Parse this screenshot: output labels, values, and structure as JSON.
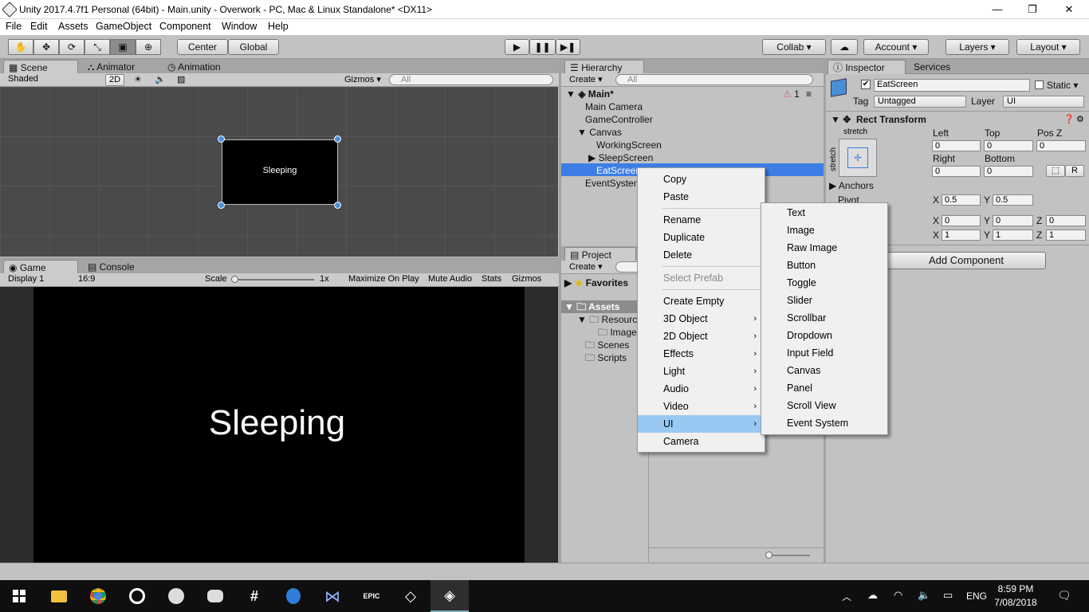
{
  "window": {
    "title": "Unity 2017.4.7f1 Personal (64bit) - Main.unity - Overwork - PC, Mac & Linux Standalone* <DX11>",
    "min": "—",
    "max": "❐",
    "close": "✕"
  },
  "menu": [
    "File",
    "Edit",
    "Assets",
    "GameObject",
    "Component",
    "Window",
    "Help"
  ],
  "toolbar": {
    "center": "Center",
    "global": "Global",
    "collab": "Collab",
    "account": "Account",
    "layers": "Layers",
    "layout": "Layout",
    "play": "▶",
    "pause": "❚❚",
    "step": "▶❚"
  },
  "scene": {
    "tabs": [
      "Scene",
      "Animator",
      "Animation"
    ],
    "shaded": "Shaded",
    "mode2d": "2D",
    "gizmos": "Gizmos",
    "search": "All",
    "canvas_text": "Sleeping"
  },
  "game": {
    "tabs": [
      "Game",
      "Console"
    ],
    "display": "Display 1",
    "aspect": "16:9",
    "scale_label": "Scale",
    "scale_val": "1x",
    "maximize": "Maximize On Play",
    "mute": "Mute Audio",
    "stats": "Stats",
    "gizmos": "Gizmos",
    "text": "Sleeping"
  },
  "hierarchy": {
    "tab": "Hierarchy",
    "create": "Create",
    "search": "All",
    "scene": "Main*",
    "count": "1",
    "items": [
      "Main Camera",
      "GameController",
      "Canvas",
      "WorkingScreen",
      "SleepScreen",
      "EatScreen",
      "EventSystem"
    ]
  },
  "project": {
    "tab": "Project",
    "create": "Create",
    "favorites": "Favorites",
    "assets": "Assets",
    "items": [
      "Resources",
      "Images",
      "Scenes",
      "Scripts"
    ]
  },
  "context_menu": {
    "items": [
      "Copy",
      "Paste",
      "Rename",
      "Duplicate",
      "Delete",
      "Select Prefab",
      "Create Empty",
      "3D Object",
      "2D Object",
      "Effects",
      "Light",
      "Audio",
      "Video",
      "UI",
      "Camera"
    ],
    "arrow": "›"
  },
  "submenu": {
    "items": [
      "Text",
      "Image",
      "Raw Image",
      "Button",
      "Toggle",
      "Slider",
      "Scrollbar",
      "Dropdown",
      "Input Field",
      "Canvas",
      "Panel",
      "Scroll View",
      "Event System"
    ]
  },
  "inspector": {
    "tabs": [
      "Inspector",
      "Services"
    ],
    "name": "EatScreen",
    "static": "Static",
    "tag_label": "Tag",
    "tag": "Untagged",
    "layer_label": "Layer",
    "layer": "UI",
    "component": "Rect Transform",
    "stretch_h": "stretch",
    "stretch_v": "stretch",
    "left_l": "Left",
    "top_l": "Top",
    "posz_l": "Pos Z",
    "left": "0",
    "top": "0",
    "posz": "0",
    "right_l": "Right",
    "bottom_l": "Bottom",
    "right": "0",
    "bottom": "0",
    "r_btn": "R",
    "anchors": "Anchors",
    "pivot": "Pivot",
    "pivot_x": "0.5",
    "pivot_y": "0.5",
    "rot_x": "0",
    "rot_y": "0",
    "rot_z": "0",
    "scale_x": "1",
    "scale_y": "1",
    "scale_z": "1",
    "x": "X",
    "y": "Y",
    "z": "Z",
    "add_component": "Add Component"
  },
  "taskbar": {
    "lang": "ENG",
    "time": "8:59 PM",
    "date": "7/08/2018"
  }
}
